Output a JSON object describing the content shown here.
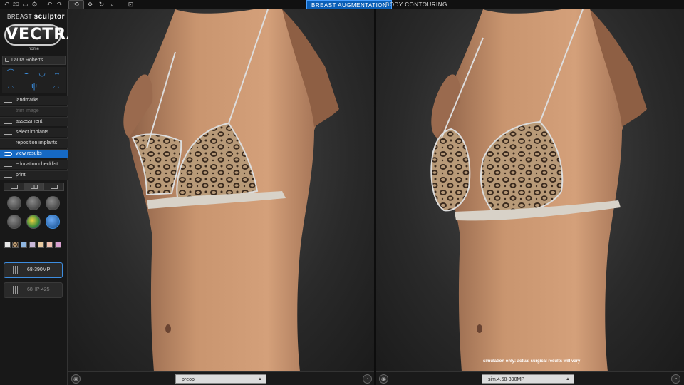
{
  "topbar": {
    "twod_label": "2D",
    "mode_tabs": [
      {
        "label": "BREAST AUGMENTATION",
        "active": true
      },
      {
        "label": "BODY CONTOURING",
        "active": false
      }
    ]
  },
  "brand": {
    "prefix": "BREAST",
    "product": "sculptor",
    "logo_text": "VECTRA",
    "home_label": "home"
  },
  "patient": {
    "name": "Laura Roberts"
  },
  "steps": [
    {
      "label": "landmarks",
      "state": "normal",
      "icon": "landmarks-icon"
    },
    {
      "label": "trim image",
      "state": "disabled",
      "icon": "trim-icon"
    },
    {
      "label": "assessment",
      "state": "normal",
      "icon": "assessment-icon"
    },
    {
      "label": "select implants",
      "state": "normal",
      "icon": "select-implants-icon"
    },
    {
      "label": "reposition implants",
      "state": "normal",
      "icon": "reposition-icon"
    },
    {
      "label": "view results",
      "state": "active",
      "icon": "eye-icon"
    },
    {
      "label": "education checklist",
      "state": "normal",
      "icon": "checklist-icon"
    },
    {
      "label": "print",
      "state": "normal",
      "icon": "printer-icon"
    }
  ],
  "swatch_colors": [
    "#e8e8e8",
    "#b89a72",
    "#8fb6e0",
    "#c9b7d8",
    "#e8c9a0",
    "#f0c0b0",
    "#d8a0d0",
    "#a8d8a8"
  ],
  "implants": [
    {
      "label": "68-390MP",
      "active": true
    },
    {
      "label": "68HP-425",
      "active": false
    }
  ],
  "viewports": {
    "left_state": "preop",
    "right_state": "sim.4.68-390MP",
    "disclaimer": "simulation only: actual surgical results will vary"
  },
  "colors": {
    "accent": "#1669c4",
    "skin": "#c9956f",
    "bikini_base": "#b59a78"
  }
}
